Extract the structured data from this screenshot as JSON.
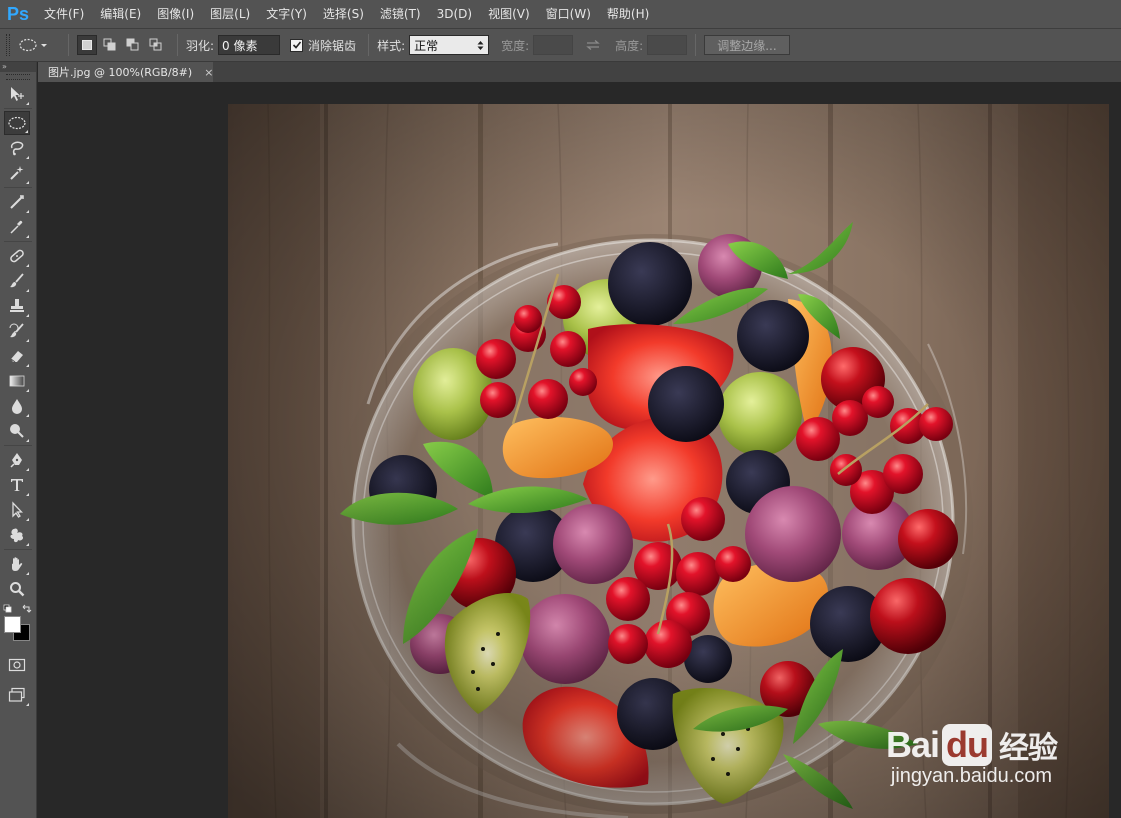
{
  "app": {
    "logo": "Ps",
    "menu": [
      "文件(F)",
      "编辑(E)",
      "图像(I)",
      "图层(L)",
      "文字(Y)",
      "选择(S)",
      "滤镜(T)",
      "3D(D)",
      "视图(V)",
      "窗口(W)",
      "帮助(H)"
    ]
  },
  "options": {
    "feather_label": "羽化:",
    "feather_value": "0 像素",
    "antialias_label": "消除锯齿",
    "antialias_checked": true,
    "style_label": "样式:",
    "style_value": "正常",
    "width_label": "宽度:",
    "height_label": "高度:",
    "refine_edge_label": "调整边缘..."
  },
  "tools": {
    "panel_arrows": "»",
    "list": [
      {
        "name": "move-tool-icon",
        "active": false
      },
      {
        "name": "elliptical-marquee-tool-icon",
        "active": true
      },
      {
        "name": "lasso-tool-icon",
        "active": false
      },
      {
        "name": "magic-wand-tool-icon",
        "active": false
      },
      {
        "name": "crop-tool-icon",
        "active": false
      },
      {
        "name": "eyedropper-tool-icon",
        "active": false
      },
      {
        "name": "healing-brush-tool-icon",
        "active": false
      },
      {
        "name": "brush-tool-icon",
        "active": false
      },
      {
        "name": "clone-stamp-tool-icon",
        "active": false
      },
      {
        "name": "history-brush-tool-icon",
        "active": false
      },
      {
        "name": "eraser-tool-icon",
        "active": false
      },
      {
        "name": "gradient-tool-icon",
        "active": false
      },
      {
        "name": "blur-tool-icon",
        "active": false
      },
      {
        "name": "dodge-tool-icon",
        "active": false
      },
      {
        "name": "pen-tool-icon",
        "active": false
      },
      {
        "name": "type-tool-icon",
        "active": false
      },
      {
        "name": "path-selection-tool-icon",
        "active": false
      },
      {
        "name": "custom-shape-tool-icon",
        "active": false
      },
      {
        "name": "hand-tool-icon",
        "active": false
      },
      {
        "name": "zoom-tool-icon",
        "active": false
      }
    ],
    "foreground_color": "#ffffff",
    "background_color": "#000000"
  },
  "document": {
    "tab_title": "图片.jpg @ 100%(RGB/8#)",
    "close_glyph": "×"
  },
  "watermark": {
    "logo_left": "Bai",
    "logo_du": "du",
    "logo_cn": "经验",
    "url": "jingyan.baidu.com"
  },
  "colors": {
    "ui_dark": "#535353",
    "canvas_bg": "#282828",
    "ps_blue": "#31a8ff"
  }
}
